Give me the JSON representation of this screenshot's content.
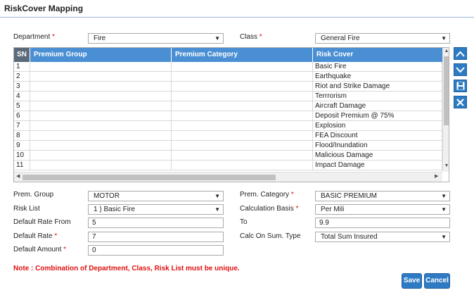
{
  "window": {
    "title": "RiskCover Mapping"
  },
  "filters": {
    "department_label": "Department",
    "department_value": "Fire",
    "class_label": "Class",
    "class_value": "General Fire",
    "required_mark": "*"
  },
  "grid": {
    "columns": [
      "SN",
      "Premium Group",
      "Premium Category",
      "Risk Cover"
    ],
    "rows": [
      {
        "sn": "1",
        "group": "",
        "category": "",
        "cover": "Basic Fire"
      },
      {
        "sn": "2",
        "group": "",
        "category": "",
        "cover": "Earthquake"
      },
      {
        "sn": "3",
        "group": "",
        "category": "",
        "cover": "Riot and Strike Damage"
      },
      {
        "sn": "4",
        "group": "",
        "category": "",
        "cover": "Terrrorism"
      },
      {
        "sn": "5",
        "group": "",
        "category": "",
        "cover": "Aircraft Damage"
      },
      {
        "sn": "6",
        "group": "",
        "category": "",
        "cover": "Deposit Premium @ 75%"
      },
      {
        "sn": "7",
        "group": "",
        "category": "",
        "cover": "Explosion"
      },
      {
        "sn": "8",
        "group": "",
        "category": "",
        "cover": "FEA Discount"
      },
      {
        "sn": "9",
        "group": "",
        "category": "",
        "cover": "Flood/Inundation"
      },
      {
        "sn": "10",
        "group": "",
        "category": "",
        "cover": "Malicious Damage"
      },
      {
        "sn": "11",
        "group": "",
        "category": "",
        "cover": "Impact Damage"
      }
    ]
  },
  "side_actions": [
    {
      "name": "move-up-icon"
    },
    {
      "name": "move-down-icon"
    },
    {
      "name": "save-icon"
    },
    {
      "name": "delete-icon"
    }
  ],
  "form": {
    "prem_group_label": "Prem. Group",
    "prem_group_value": "MOTOR",
    "prem_category_label": "Prem. Category",
    "prem_category_value": "BASIC PREMIUM",
    "risk_list_label": "Risk List",
    "risk_list_value": "1 ) Basic Fire",
    "calc_basis_label": "Calculation Basis",
    "calc_basis_value": "Per Mili",
    "rate_from_label": "Default Rate From",
    "rate_from_value": "5",
    "to_label": "To",
    "to_value": "9.9",
    "default_rate_label": "Default Rate",
    "default_rate_value": "7",
    "calc_on_label": "Calc On Sum. Type",
    "calc_on_value": "Total Sum Insured",
    "default_amount_label": "Default Amount",
    "default_amount_value": "0"
  },
  "note": "Note : Combination of Department, Class, Risk List must be unique.",
  "buttons": {
    "save": "Save",
    "cancel": "Cancel"
  },
  "colors": {
    "accent": "#2e7bc4",
    "header": "#4a8fd4",
    "note": "#e01010"
  }
}
